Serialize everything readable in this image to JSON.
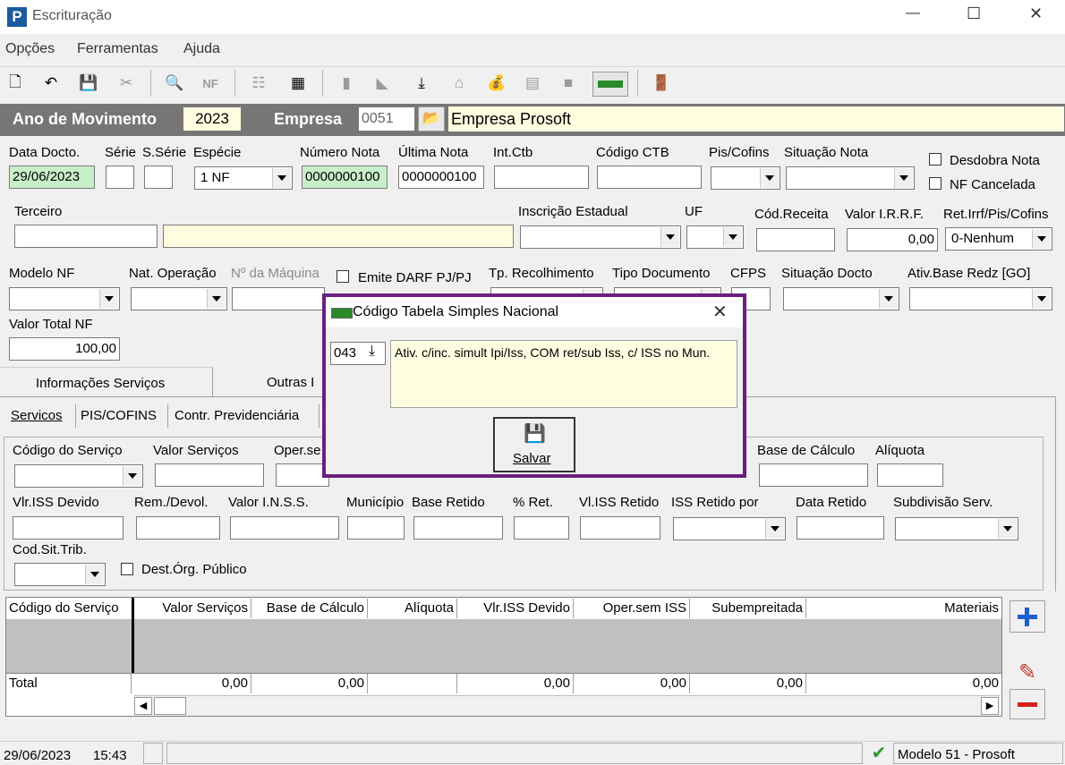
{
  "window": {
    "title": "Escrituração",
    "minimize": "—",
    "maximize": "☐",
    "close": "✕"
  },
  "menu": [
    "Opções",
    "Ferramentas",
    "Ajuda"
  ],
  "header": {
    "ano_label": "Ano de Movimento",
    "ano_value": "2023",
    "empresa_label": "Empresa",
    "empresa_code": "0051",
    "empresa_name": "Empresa Prosoft"
  },
  "form": {
    "data_docto": {
      "label": "Data Docto.",
      "value": "29/06/2023"
    },
    "serie": {
      "label": "Série",
      "value": ""
    },
    "sserie": {
      "label": "S.Série",
      "value": ""
    },
    "especie": {
      "label": "Espécie",
      "value": "1 NF"
    },
    "numero_nota": {
      "label": "Número Nota",
      "value": "0000000100"
    },
    "ultima_nota": {
      "label": "Última Nota",
      "value": "0000000100"
    },
    "int_ctb": {
      "label": "Int.Ctb",
      "value": ""
    },
    "codigo_ctb": {
      "label": "Código CTB",
      "value": ""
    },
    "pis_cofins": {
      "label": "Pis/Cofins",
      "value": ""
    },
    "situacao_nota": {
      "label": "Situação Nota",
      "value": ""
    },
    "desdobra_nota": "Desdobra Nota",
    "nf_cancelada": "NF Cancelada",
    "terceiro": {
      "label": "Terceiro",
      "value": ""
    },
    "inscricao_estadual": {
      "label": "Inscrição Estadual",
      "value": ""
    },
    "uf": {
      "label": "UF",
      "value": ""
    },
    "cod_receita": {
      "label": "Cód.Receita",
      "value": ""
    },
    "valor_irrf": {
      "label": "Valor I.R.R.F.",
      "value": "0,00"
    },
    "ret_irrf": {
      "label": "Ret.Irrf/Pis/Cofins",
      "value": "0-Nenhum"
    },
    "modelo_nf": {
      "label": "Modelo NF",
      "value": ""
    },
    "nat_operacao": {
      "label": "Nat. Operação",
      "value": ""
    },
    "num_maquina": {
      "label": "Nº da Máquina",
      "value": ""
    },
    "emite_darf": "Emite DARF PJ/PJ",
    "tp_recolhimento": {
      "label": "Tp. Recolhimento"
    },
    "tipo_documento": {
      "label": "Tipo Documento"
    },
    "cfps": {
      "label": "CFPS"
    },
    "situacao_docto": {
      "label": "Situação Docto",
      "value": ""
    },
    "ativ_base_redz": {
      "label": "Ativ.Base Redz [GO]",
      "value": ""
    },
    "valor_total_nf": {
      "label": "Valor Total NF",
      "value": "100,00"
    }
  },
  "tabs_main": [
    "Informações Serviços",
    "Outras I"
  ],
  "tabs_sub": [
    "Servicos",
    "PIS/COFINS",
    "Contr. Previdenciária"
  ],
  "servicos": {
    "codigo_servico": "Código do Serviço",
    "valor_servicos": "Valor Serviços",
    "oper_sem_iss": "Oper.se",
    "base_calculo": "Base de Cálculo",
    "aliquota": "Alíquota",
    "vlr_iss_devido": "Vlr.ISS Devido",
    "rem_devol": "Rem./Devol.",
    "valor_inss": "Valor I.N.S.S.",
    "municipio": "Município",
    "base_retido": "Base Retido",
    "pct_ret": "% Ret.",
    "vl_iss_retido": "Vl.ISS Retido",
    "iss_retido_por": "ISS Retido por",
    "data_retido": "Data Retido",
    "subdivisao_serv": "Subdivisão Serv.",
    "cod_sit_trib": "Cod.Sit.Trib.",
    "dest_org_publico": "Dest.Órg. Público"
  },
  "grid": {
    "columns": [
      "Código do Serviço",
      "Valor Serviços",
      "Base de Cálculo",
      "Alíquota",
      "Vlr.ISS Devido",
      "Oper.sem ISS",
      "Subempreitada",
      "Materiais"
    ],
    "total_label": "Total",
    "totals": [
      "0,00",
      "0,00",
      "0,00",
      "0,00",
      "0,00",
      "0,00"
    ]
  },
  "dialog": {
    "title": "Código Tabela Simples Nacional",
    "code": "043",
    "description": "Ativ. c/inc. simult Ipi/Iss, COM ret/sub Iss, c/ ISS no Mun.",
    "save_label": "Salvar"
  },
  "status": {
    "date": "29/06/2023",
    "time": "15:43",
    "model": "Modelo 51 - Prosoft"
  },
  "colors": {
    "header_bar": "#767676",
    "dialog_border": "#6b1f7e",
    "green_field": "#c8f0c8",
    "yellow_field": "#fffde0",
    "add": "#1c5fd0",
    "remove": "#d42020"
  }
}
